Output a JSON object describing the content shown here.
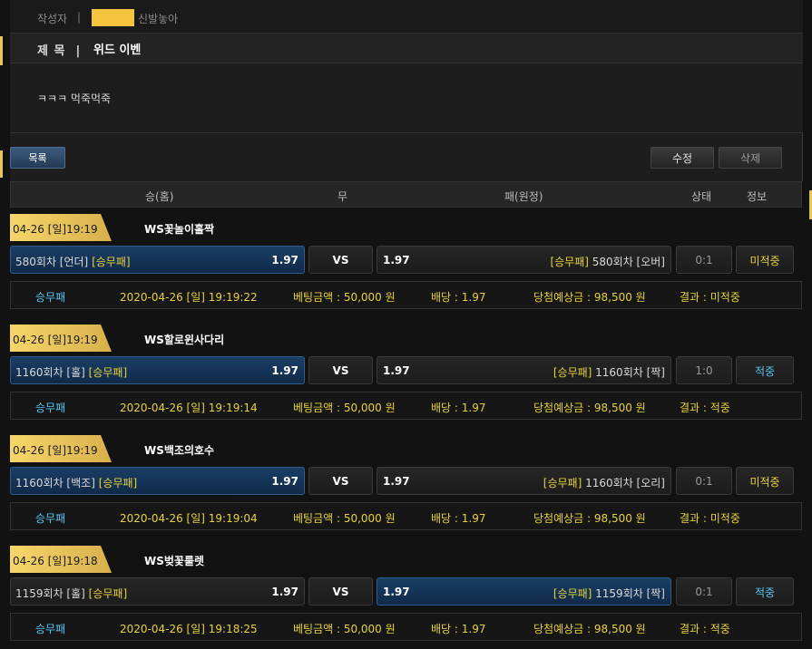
{
  "post": {
    "author_label": "작성자",
    "author_separator": "|",
    "author_name": "신발놓아",
    "title_label": "제 목",
    "title_separator": "|",
    "title": "위드 이벤",
    "content": "ㅋㅋㅋ 먹죽먹죽"
  },
  "buttons": {
    "list": "목록",
    "edit": "수정",
    "delete": "삭제"
  },
  "columns": {
    "home": "승(홈)",
    "draw": "무",
    "away": "패(원정)",
    "status": "상태",
    "info": "정보"
  },
  "colors": {
    "accent_gold": "#e8c45a",
    "selected_blue": "#1a3e66",
    "yellow_text": "#e7d23b",
    "cyan_text": "#56c6f5"
  },
  "bets": [
    {
      "time": "04-26 [일]19:19",
      "league": "WS꽃놀이홀짝",
      "home_team": "580회차 [언더]",
      "home_tag": "[승무패]",
      "home_odds": "1.97",
      "vs": "VS",
      "away_odds": "1.97",
      "away_tag": "[승무패]",
      "away_team": "580회차 [오버]",
      "score": "0:1",
      "status": "미적중",
      "info_type": "승무패",
      "info_date": "2020-04-26 [일] 19:19:22",
      "info_amount": "베팅금액 : 50,000 원",
      "info_rate": "배당 : 1.97",
      "info_win": "당첨예상금 : 98,500 원",
      "info_result": "결과 : 미적중"
    },
    {
      "time": "04-26 [일]19:19",
      "league": "WS할로윈사다리",
      "home_team": "1160회차 [홀]",
      "home_tag": "[승무패]",
      "home_odds": "1.97",
      "vs": "VS",
      "away_odds": "1.97",
      "away_tag": "[승무패]",
      "away_team": "1160회차 [짝]",
      "score": "1:0",
      "status": "적중",
      "info_type": "승무패",
      "info_date": "2020-04-26 [일] 19:19:14",
      "info_amount": "베팅금액 : 50,000 원",
      "info_rate": "배당 : 1.97",
      "info_win": "당첨예상금 : 98,500 원",
      "info_result": "결과 : 적중"
    },
    {
      "time": "04-26 [일]19:19",
      "league": "WS백조의호수",
      "home_team": "1160회차 [백조]",
      "home_tag": "[승무패]",
      "home_odds": "1.97",
      "vs": "VS",
      "away_odds": "1.97",
      "away_tag": "[승무패]",
      "away_team": "1160회차 [오리]",
      "score": "0:1",
      "status": "미적중",
      "info_type": "승무패",
      "info_date": "2020-04-26 [일] 19:19:04",
      "info_amount": "베팅금액 : 50,000 원",
      "info_rate": "배당 : 1.97",
      "info_win": "당첨예상금 : 98,500 원",
      "info_result": "결과 : 미적중"
    },
    {
      "time": "04-26 [일]19:18",
      "league": "WS벚꽃룰렛",
      "home_team": "1159회차 [홀]",
      "home_tag": "[승무패]",
      "home_odds": "1.97",
      "vs": "VS",
      "away_odds": "1.97",
      "away_tag": "[승무패]",
      "away_team": "1159회차 [짝]",
      "score": "0:1",
      "status": "적중",
      "info_type": "승무패",
      "info_date": "2020-04-26 [일] 19:18:25",
      "info_amount": "베팅금액 : 50,000 원",
      "info_rate": "배당 : 1.97",
      "info_win": "당첨예상금 : 98,500 원",
      "info_result": "결과 : 적중"
    }
  ]
}
